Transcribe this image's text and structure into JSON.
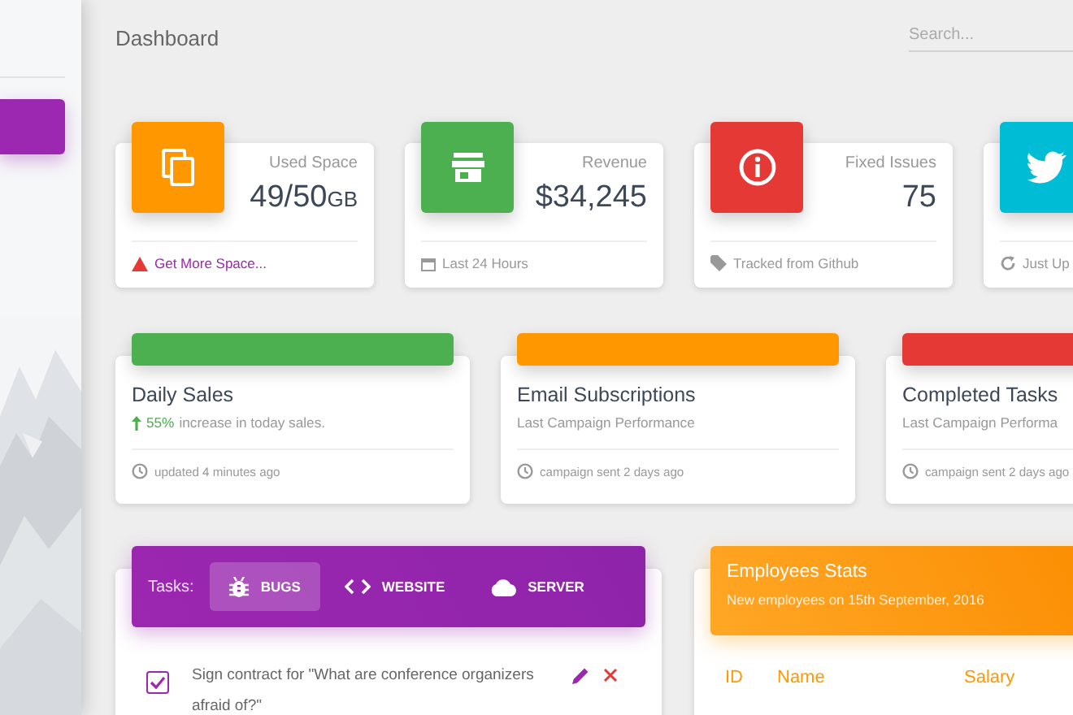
{
  "sidebar": {
    "items": [
      {
        "selected": true
      }
    ]
  },
  "header": {
    "title": "Dashboard",
    "search": {
      "placeholder": "Search..."
    }
  },
  "stats": [
    {
      "color": "#ff9800",
      "label": "Used Space",
      "value": "49/50",
      "unit": "GB",
      "footer": "Get More Space...",
      "footer_link": true
    },
    {
      "color": "#4caf50",
      "label": "Revenue",
      "value": "$34,245",
      "footer": "Last 24 Hours",
      "footer_link": false
    },
    {
      "color": "#e53935",
      "label": "Fixed Issues",
      "value": "75",
      "footer": "Tracked from Github",
      "footer_link": false
    },
    {
      "color": "#00bcd4",
      "footer": "Just Up",
      "footer_link": false
    }
  ],
  "charts": [
    {
      "color": "#4caf50",
      "title": "Daily Sales",
      "highlight": "55%",
      "subtitle": "increase in today sales.",
      "footer": "updated 4 minutes ago"
    },
    {
      "color": "#ff9800",
      "title": "Email Subscriptions",
      "subtitle": "Last Campaign Performance",
      "footer": "campaign sent 2 days ago"
    },
    {
      "color": "#e53935",
      "title": "Completed Tasks",
      "subtitle": "Last Campaign Performa",
      "footer": "campaign sent 2 days ago"
    }
  ],
  "tasks": {
    "label": "Tasks:",
    "tabs": [
      {
        "label": "BUGS",
        "selected": true
      },
      {
        "label": "WEBSITE",
        "selected": false
      },
      {
        "label": "SERVER",
        "selected": false
      }
    ],
    "items": [
      {
        "text": "Sign contract for \"What are conference organizers afraid of?\"",
        "checked": true
      }
    ]
  },
  "employees": {
    "title": "Employees Stats",
    "subtitle": "New employees on 15th September, 2016",
    "columns": [
      "ID",
      "Name",
      "Salary"
    ]
  }
}
